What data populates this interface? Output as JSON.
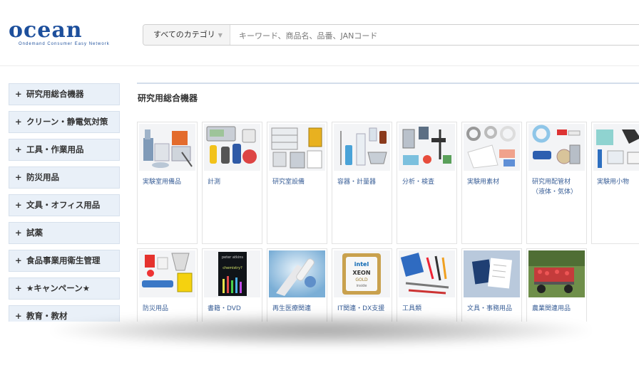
{
  "header": {
    "logo": {
      "word": "ocean",
      "tagline": "Ondemand Consumer Easy Network"
    },
    "search": {
      "category_label": "すべてのカテゴリ",
      "placeholder": "キーワード、商品名、品番、JANコード"
    }
  },
  "sidebar": {
    "items": [
      {
        "label": "研究用総合機器"
      },
      {
        "label": "クリーン・静電気対策"
      },
      {
        "label": "工具・作業用品"
      },
      {
        "label": "防災用品"
      },
      {
        "label": "文具・オフィス用品"
      },
      {
        "label": "試薬"
      },
      {
        "label": "食品事業用衛生管理"
      },
      {
        "label": "★キャンペーン★"
      },
      {
        "label": "教育・教材"
      }
    ]
  },
  "main": {
    "section_title": "研究用総合機器",
    "cards_row1": [
      {
        "label": "実験室用備品",
        "icon": "lab-equipment-photo"
      },
      {
        "label": "計測",
        "icon": "measuring-instruments-photo"
      },
      {
        "label": "研究室設備",
        "icon": "lab-facility-photo"
      },
      {
        "label": "容器・計量器",
        "icon": "containers-photo"
      },
      {
        "label": "分析・検査",
        "icon": "analysis-photo"
      },
      {
        "label": "実験用素材",
        "icon": "materials-photo"
      },
      {
        "label": "研究用配管材\n（液体・気体）",
        "icon": "piping-photo"
      },
      {
        "label": "実験用小物",
        "icon": "small-items-photo"
      }
    ],
    "cards_row2": [
      {
        "label": "防災用品",
        "icon": "disaster-kit-photo"
      },
      {
        "label": "書籍・DVD",
        "icon": "book-photo",
        "book_author": "peter atkins",
        "book_title": "chemistry?"
      },
      {
        "label": "再生医療関連",
        "icon": "regenerative-medicine-photo"
      },
      {
        "label": "IT関連・DX支援",
        "icon": "cpu-chip-photo",
        "chip_brand": "intel",
        "chip_name": "XEON",
        "chip_tier": "GOLD",
        "chip_inside": "inside"
      },
      {
        "label": "工具類",
        "icon": "tools-photo"
      },
      {
        "label": "文具・事務用品",
        "icon": "stationery-photo"
      },
      {
        "label": "農業関連用品",
        "icon": "agriculture-photo"
      }
    ]
  },
  "colors": {
    "brand": "#1d4f9c",
    "link": "#3a5f97",
    "sidebar_bg": "#e9f0f8"
  }
}
